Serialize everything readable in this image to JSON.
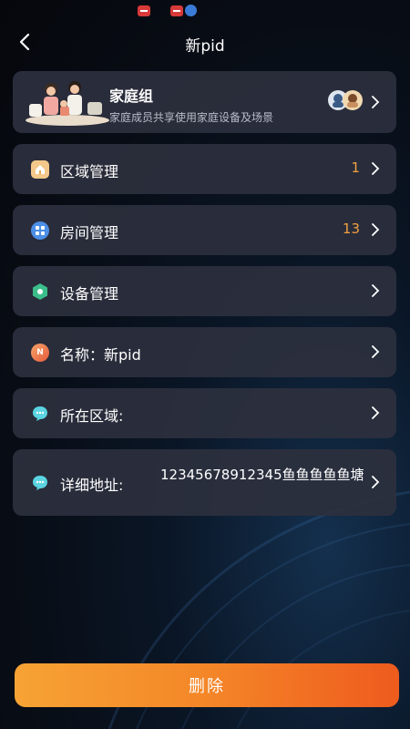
{
  "header": {
    "title": "新pid"
  },
  "family": {
    "title": "家庭组",
    "subtitle": "家庭成员共享使用家庭设备及场景"
  },
  "rows": [
    {
      "label": "区域管理",
      "count": "1"
    },
    {
      "label": "房间管理",
      "count": "13"
    },
    {
      "label": "设备管理"
    },
    {
      "label": "名称：新pid",
      "icon_text": "N"
    },
    {
      "label": "所在区域:"
    },
    {
      "label": "详细地址:",
      "value": "12345678912345鱼鱼鱼鱼鱼塘"
    }
  ],
  "actions": {
    "delete_label": "删除"
  },
  "colors": {
    "accent_orange": "#f48628",
    "count_orange": "#f0a040",
    "card_bg": "#2c303e"
  },
  "icons": [
    "back-arrow-icon",
    "home-icon",
    "grid-icon",
    "hexagon-device-icon",
    "name-n-icon",
    "chat-bubble-icon",
    "chevron-right-icon"
  ]
}
